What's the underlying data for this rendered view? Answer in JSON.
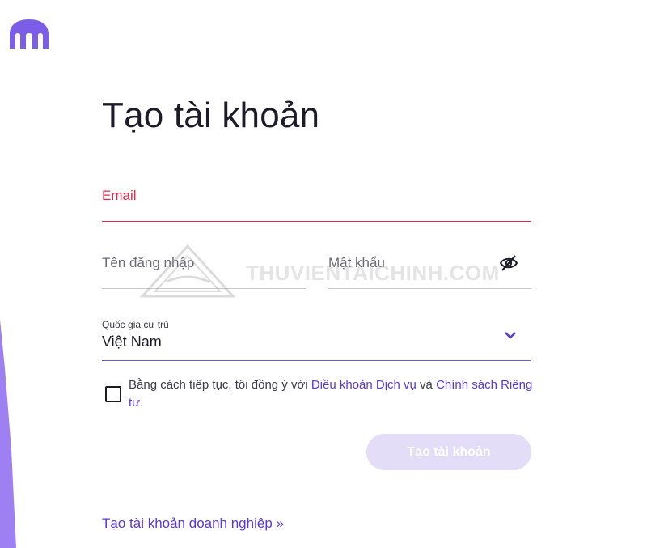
{
  "brand": {
    "logo_icon": "kraken-logo-icon",
    "accent_color": "#7b5ee7"
  },
  "page": {
    "title": "Tạo tài khoản"
  },
  "form": {
    "email": {
      "label": "Email",
      "error_color": "#e0294b"
    },
    "username": {
      "placeholder": "Tên đăng nhập"
    },
    "password": {
      "placeholder": "Mật khẩu",
      "toggle_icon": "eye-slash-icon"
    },
    "country": {
      "label": "Quốc gia cư trú",
      "value": "Việt Nam",
      "icon": "chevron-down-icon"
    },
    "consent": {
      "prefix": "Bằng cách tiếp tục, tôi đồng ý với ",
      "terms_link": "Điều khoản Dịch vụ",
      "middle": " và ",
      "privacy_link": "Chính sách Riêng tư",
      "suffix": "."
    },
    "submit_label": "Tạo tài khoản"
  },
  "footer": {
    "business_link": "Tạo tài khoản doanh nghiệp »"
  },
  "watermark": {
    "text": "THUVIENTAICHINH.COM"
  }
}
